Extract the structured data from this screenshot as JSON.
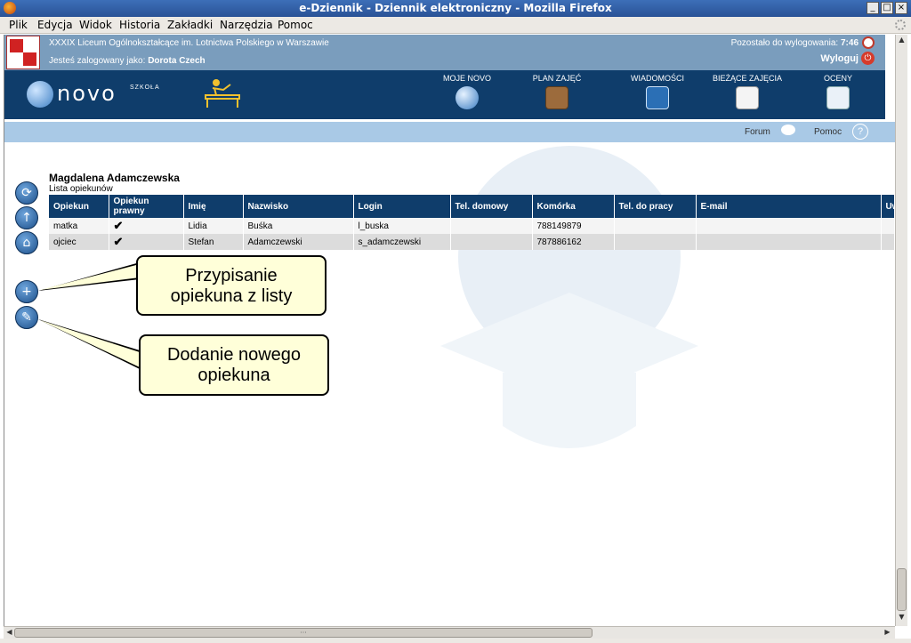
{
  "window": {
    "title": "e-Dziennik - Dziennik elektroniczny - Mozilla Firefox",
    "min": "_",
    "max": "□",
    "close": "×"
  },
  "menu": {
    "items": [
      "Plik",
      "Edycja",
      "Widok",
      "Historia",
      "Zakładki",
      "Narzędzia",
      "Pomoc"
    ]
  },
  "header": {
    "school": "XXXIX Liceum Ogólnokształcące im. Lotnictwa Polskiego w Warszawie",
    "logged_prefix": "Jesteś zalogowany jako:",
    "user": "Dorota Czech",
    "remaining_label": "Pozostało do wylogowania:",
    "remaining_time": "7:46",
    "logout": "Wyloguj"
  },
  "nav": {
    "brand": "novo",
    "brand_sub": "SZKOŁA",
    "items": [
      "MOJE NOVO",
      "PLAN ZAJĘĆ",
      "WIADOMOŚCI",
      "BIEŻĄCE ZAJĘCIA",
      "OCENY"
    ]
  },
  "subnav": {
    "forum": "Forum",
    "help": "Pomoc",
    "help_glyph": "?"
  },
  "content": {
    "student_name": "Magdalena Adamczewska",
    "list_title": "Lista opiekunów",
    "columns": [
      "Opiekun",
      "Opiekun prawny",
      "Imię",
      "Nazwisko",
      "Login",
      "Tel. domowy",
      "Komórka",
      "Tel. do pracy",
      "E-mail",
      "Uw"
    ],
    "rows": [
      {
        "opiekun": "matka",
        "prawny": "✔",
        "imie": "Lidia",
        "nazwisko": "Buśka",
        "login": "l_buska",
        "tel_dom": "",
        "komorka": "788149879",
        "tel_praca": "",
        "email": "",
        "uw": ""
      },
      {
        "opiekun": "ojciec",
        "prawny": "✔",
        "imie": "Stefan",
        "nazwisko": "Adamczewski",
        "login": "s_adamczewski",
        "tel_dom": "",
        "komorka": "787886162",
        "tel_praca": "",
        "email": "",
        "uw": ""
      }
    ]
  },
  "callouts": {
    "assign_line1": "Przypisanie",
    "assign_line2": "opiekuna z listy",
    "add_line1": "Dodanie nowego",
    "add_line2": "opiekuna"
  },
  "side_buttons": {
    "refresh": "⟳",
    "up": "↑",
    "home": "⌂",
    "add": "+",
    "edit": "✎"
  },
  "scroll": {
    "up": "▲",
    "down": "▼",
    "left": "◀",
    "right": "▶",
    "grip": "···"
  },
  "colors": {
    "nav_bg": "#0f3d6b",
    "school_bar": "#7a9dbd",
    "subbar": "#a9c9e6",
    "callout_bg": "#ffffd9"
  }
}
